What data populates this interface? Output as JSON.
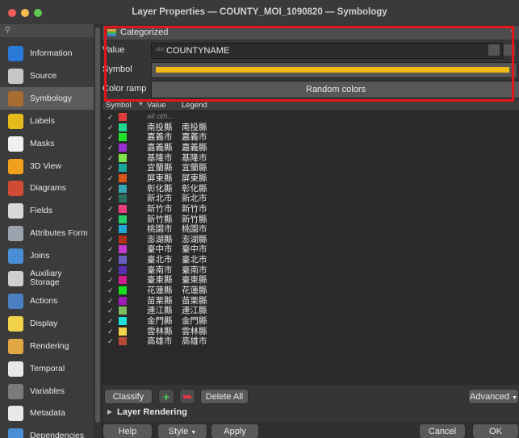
{
  "window": {
    "title": "Layer Properties — COUNTY_MOI_1090820 — Symbology",
    "traffic_lights": [
      "#ee5f5a",
      "#f5bd4f",
      "#61c454"
    ]
  },
  "sidebar": {
    "items": [
      {
        "label": "Information",
        "icon": "info-icon",
        "color": "#2a78d8"
      },
      {
        "label": "Source",
        "icon": "source-icon",
        "color": "#c7c7c7"
      },
      {
        "label": "Symbology",
        "icon": "symbology-icon",
        "color": "#a86b32",
        "active": true
      },
      {
        "label": "Labels",
        "icon": "labels-icon",
        "color": "#e6b91c"
      },
      {
        "label": "Masks",
        "icon": "masks-icon",
        "color": "#f0f0f0"
      },
      {
        "label": "3D View",
        "icon": "3d-view-icon",
        "color": "#f0a01c"
      },
      {
        "label": "Diagrams",
        "icon": "diagrams-icon",
        "color": "#d14a35"
      },
      {
        "label": "Fields",
        "icon": "fields-icon",
        "color": "#d8d8d8"
      },
      {
        "label": "Attributes Form",
        "icon": "attributes-form-icon",
        "color": "#9aa3ad"
      },
      {
        "label": "Joins",
        "icon": "joins-icon",
        "color": "#4a8fd6"
      },
      {
        "label": "Auxiliary Storage",
        "label_l1": "Auxiliary",
        "label_l2": "Storage",
        "icon": "auxiliary-storage-icon",
        "color": "#cfcfcf"
      },
      {
        "label": "Actions",
        "icon": "actions-icon",
        "color": "#4a7fc2"
      },
      {
        "label": "Display",
        "icon": "display-icon",
        "color": "#f3d24b"
      },
      {
        "label": "Rendering",
        "icon": "rendering-icon",
        "color": "#e1a743"
      },
      {
        "label": "Temporal",
        "icon": "temporal-icon",
        "color": "#e8e8e8"
      },
      {
        "label": "Variables",
        "icon": "variables-icon",
        "color": "#7b7b7b"
      },
      {
        "label": "Metadata",
        "icon": "metadata-icon",
        "color": "#e8e8e8"
      },
      {
        "label": "Dependencies",
        "icon": "dependencies-icon",
        "color": "#4a8fd6"
      }
    ]
  },
  "renderer": {
    "type_label": "Categorized",
    "value_label": "Value",
    "value_field": "COUNTYNAME",
    "value_prefix": "abc",
    "symbol_label": "Symbol",
    "symbol_color": "#f0b915",
    "color_ramp_label": "Color ramp",
    "color_ramp_value": "Random colors"
  },
  "table": {
    "headers": [
      "Symbol",
      "Value",
      "Legend"
    ],
    "rows": [
      {
        "color": "#e03c3c",
        "value": "all oth...",
        "legend": "",
        "other": true
      },
      {
        "color": "#1fd68a",
        "value": "南投縣",
        "legend": "南投縣"
      },
      {
        "color": "#23e02b",
        "value": "嘉義市",
        "legend": "嘉義市"
      },
      {
        "color": "#9a2ed6",
        "value": "嘉義縣",
        "legend": "嘉義縣"
      },
      {
        "color": "#7fe34a",
        "value": "基隆市",
        "legend": "基隆市"
      },
      {
        "color": "#19a89c",
        "value": "宜蘭縣",
        "legend": "宜蘭縣"
      },
      {
        "color": "#d9561a",
        "value": "屏東縣",
        "legend": "屏東縣"
      },
      {
        "color": "#35a6b3",
        "value": "彰化縣",
        "legend": "彰化縣"
      },
      {
        "color": "#2a6f5f",
        "value": "新北市",
        "legend": "新北市"
      },
      {
        "color": "#ea3f7a",
        "value": "新竹市",
        "legend": "新竹市"
      },
      {
        "color": "#24d06a",
        "value": "新竹縣",
        "legend": "新竹縣"
      },
      {
        "color": "#20a9d6",
        "value": "桃園市",
        "legend": "桃園市"
      },
      {
        "color": "#b5301c",
        "value": "澎湖縣",
        "legend": "澎湖縣"
      },
      {
        "color": "#c03ad0",
        "value": "臺中市",
        "legend": "臺中市"
      },
      {
        "color": "#6a5fc0",
        "value": "臺北市",
        "legend": "臺北市"
      },
      {
        "color": "#5a2fb0",
        "value": "臺南市",
        "legend": "臺南市"
      },
      {
        "color": "#d11c8c",
        "value": "臺東縣",
        "legend": "臺東縣"
      },
      {
        "color": "#17e020",
        "value": "花蓮縣",
        "legend": "花蓮縣"
      },
      {
        "color": "#a01ab8",
        "value": "苗栗縣",
        "legend": "苗栗縣"
      },
      {
        "color": "#7dbb5c",
        "value": "連江縣",
        "legend": "連江縣"
      },
      {
        "color": "#1fe0d8",
        "value": "金門縣",
        "legend": "金門縣"
      },
      {
        "color": "#f3d448",
        "value": "雲林縣",
        "legend": "雲林縣"
      },
      {
        "color": "#b84a36",
        "value": "高雄市",
        "legend": "高雄市"
      }
    ]
  },
  "actions": {
    "classify": "Classify",
    "delete_all": "Delete All",
    "advanced": "Advanced",
    "layer_rendering": "Layer Rendering"
  },
  "footer": {
    "help": "Help",
    "style": "Style",
    "apply": "Apply",
    "cancel": "Cancel",
    "ok": "OK"
  }
}
